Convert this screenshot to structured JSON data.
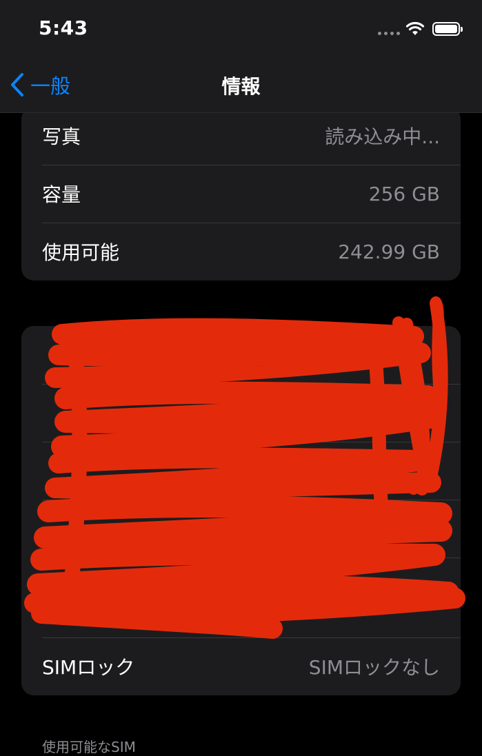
{
  "status_bar": {
    "time": "5:43"
  },
  "nav": {
    "back_label": "一般",
    "title": "情報"
  },
  "storage_rows": [
    {
      "label": "写真",
      "value": "読み込み中..."
    },
    {
      "label": "容量",
      "value": "256 GB"
    },
    {
      "label": "使用可能",
      "value": "242.99 GB"
    }
  ],
  "network_rows": [
    {
      "label": "",
      "value": ""
    },
    {
      "label": "",
      "value": ""
    },
    {
      "label": "",
      "value": ""
    },
    {
      "label": "",
      "value": ""
    },
    {
      "label": "",
      "value": ""
    },
    {
      "label": "SIMロック",
      "value": "SIMロックなし"
    }
  ],
  "footer": {
    "section_label": "使用可能なSIM"
  },
  "colors": {
    "accent": "#0a84ff",
    "background": "#000000",
    "group_bg": "#1c1c1e",
    "redaction": "#e32b0b"
  }
}
